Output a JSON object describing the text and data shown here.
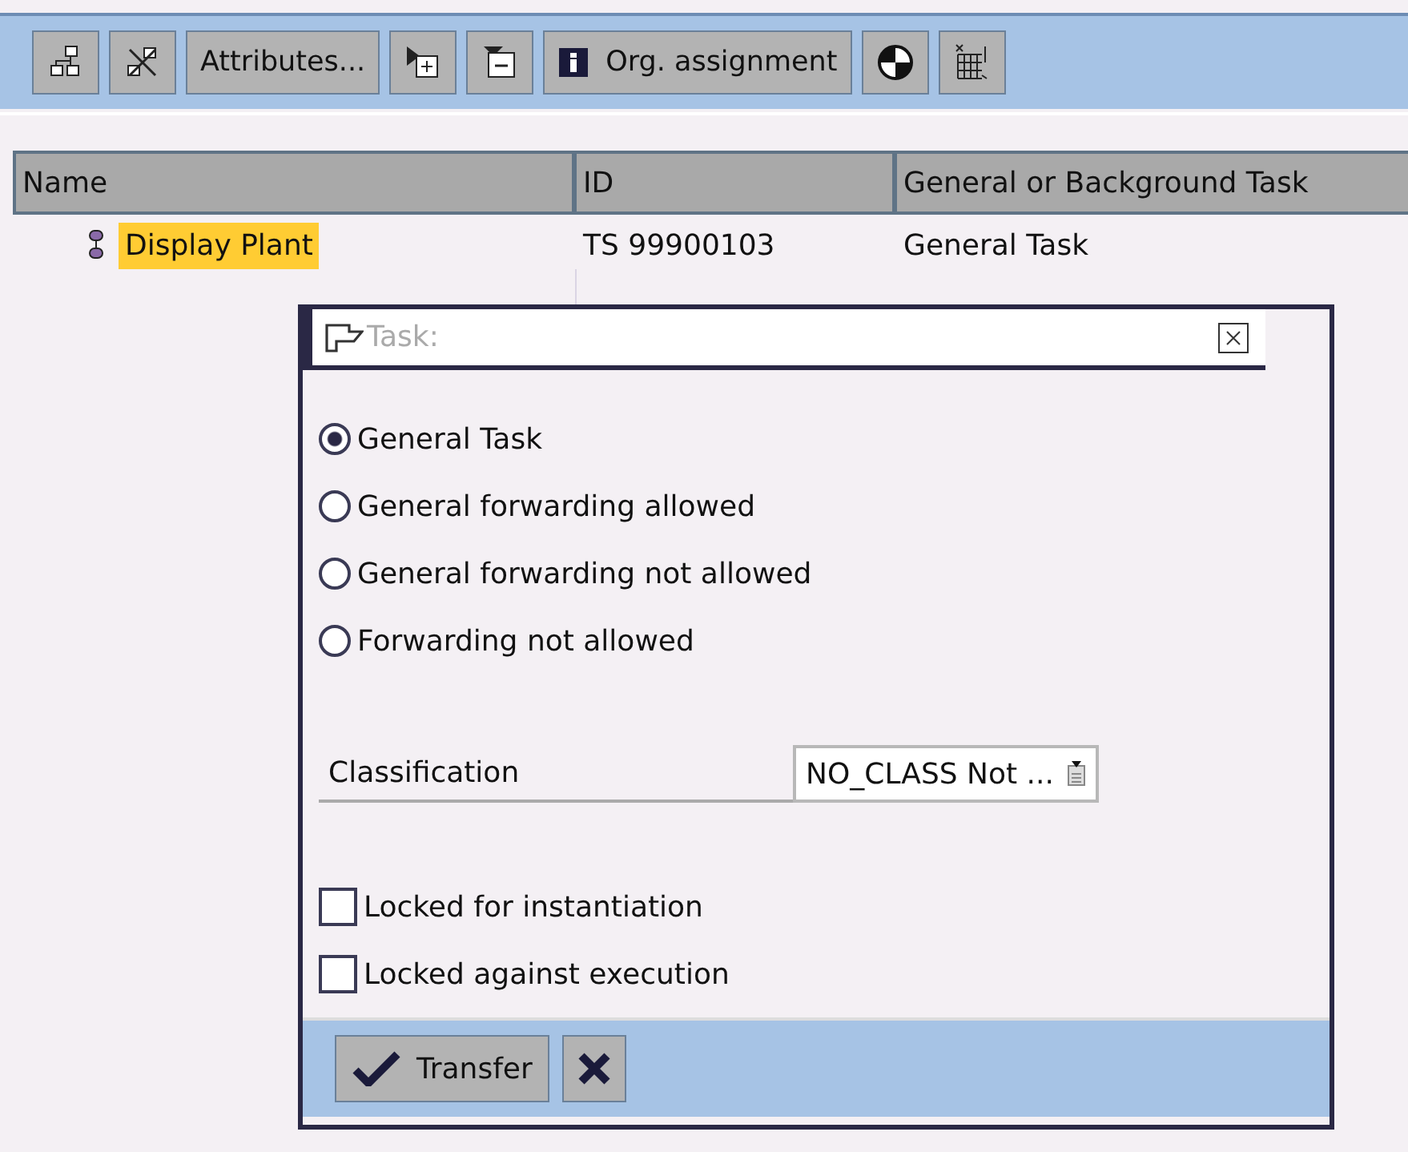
{
  "toolbar": [
    {
      "kind": "icon"
    },
    {
      "kind": "icon"
    },
    {
      "kind": "text",
      "label": "Attributes..."
    },
    {
      "kind": "icon"
    },
    {
      "kind": "icon"
    },
    {
      "kind": "icon-text",
      "label": "Org. assignment"
    },
    {
      "kind": "icon"
    },
    {
      "kind": "icon"
    }
  ],
  "table": {
    "columns": [
      "Name",
      "ID",
      "General or Background Task"
    ],
    "rows": [
      {
        "name": "Display Plant",
        "selected": true,
        "id": "TS 99900103",
        "task_type": "General Task"
      }
    ]
  },
  "dialog": {
    "title": "Task:",
    "radios": [
      {
        "label": "General Task",
        "selected": true
      },
      {
        "label": "General forwarding allowed",
        "selected": false
      },
      {
        "label": "General forwarding not allowed",
        "selected": false
      },
      {
        "label": "Forwarding not allowed",
        "selected": false
      }
    ],
    "classification": {
      "label": "Classification",
      "value": "NO_CLASS Not ..."
    },
    "checkboxes": [
      {
        "label": "Locked for instantiation",
        "checked": false
      },
      {
        "label": "Locked against execution",
        "checked": false
      }
    ],
    "buttons": [
      {
        "kind": "confirm",
        "label": "Transfer"
      },
      {
        "kind": "cancel"
      }
    ]
  }
}
